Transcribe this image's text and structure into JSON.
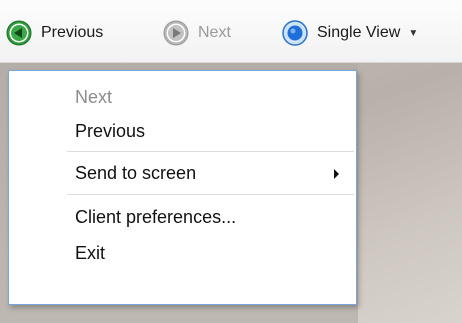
{
  "toolbar": {
    "previous_label": "Previous",
    "next_label": "Next",
    "single_view_label": "Single View"
  },
  "icons": {
    "previous": "arrow-left-circle-icon",
    "next": "arrow-right-circle-icon",
    "single_view": "radio-dot-icon",
    "dropdown": "caret-down-icon",
    "submenu": "caret-right-icon"
  },
  "colors": {
    "previous_icon": "#2e9a3a",
    "next_icon_disabled": "#a9a9a9",
    "single_view_icon": "#1e6fd9",
    "menu_border": "#7aa7d9"
  },
  "menu": {
    "items": [
      {
        "label": "Next",
        "enabled": false
      },
      {
        "label": "Previous",
        "enabled": true
      },
      {
        "label": "Send to screen",
        "enabled": true,
        "has_submenu": true
      },
      {
        "label": "Client preferences...",
        "enabled": true
      },
      {
        "label": "Exit",
        "enabled": true
      }
    ]
  }
}
